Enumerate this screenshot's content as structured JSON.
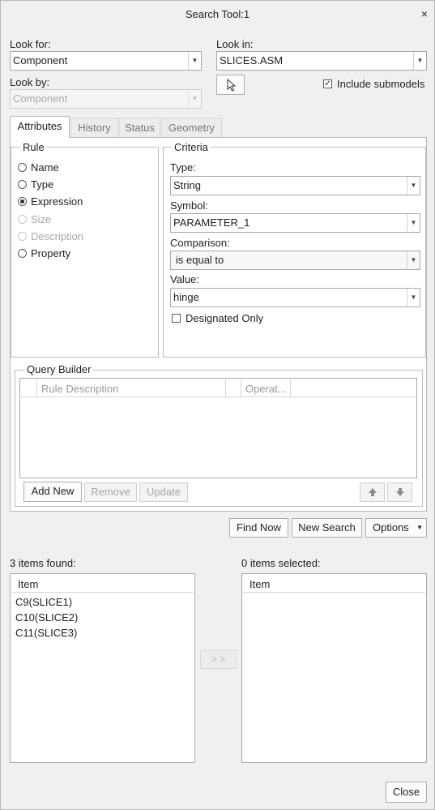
{
  "window": {
    "title": "Search Tool:1",
    "close_glyph": "×"
  },
  "look_for": {
    "label": "Look for:",
    "value": "Component"
  },
  "look_in": {
    "label": "Look in:",
    "value": "SLICES.ASM"
  },
  "look_by": {
    "label": "Look by:",
    "value": "Component"
  },
  "include_submodels": {
    "label": "Include submodels",
    "checked": true
  },
  "tabs": [
    "Attributes",
    "History",
    "Status",
    "Geometry"
  ],
  "rule": {
    "title": "Rule",
    "options": [
      "Name",
      "Type",
      "Expression",
      "Size",
      "Description",
      "Property"
    ],
    "selected": "Expression",
    "disabled": [
      "Size",
      "Description"
    ]
  },
  "criteria": {
    "title": "Criteria",
    "type_label": "Type:",
    "type_value": "String",
    "symbol_label": "Symbol:",
    "symbol_value": "PARAMETER_1",
    "comparison_label": "Comparison:",
    "comparison_value": "is equal to",
    "value_label": "Value:",
    "value_value": "hinge",
    "designated_only": "Designated Only"
  },
  "query_builder": {
    "title": "Query Builder",
    "columns": [
      "Rule Description",
      "Operat..."
    ],
    "add_new": "Add New",
    "remove": "Remove",
    "update": "Update",
    "up_glyph": "🡅",
    "down_glyph": "🡇"
  },
  "actions": {
    "find_now": "Find Now",
    "new_search": "New Search",
    "options": "Options"
  },
  "results": {
    "found_label": "3 items found:",
    "selected_label": "0 items selected:",
    "column": "Item",
    "found_items": [
      "C9(SLICE1)",
      "C10(SLICE2)",
      "C11(SLICE3)"
    ],
    "move_glyph": "> >"
  },
  "close_button": "Close",
  "icons": {
    "dropdown": "chevron-down-icon",
    "pick": "cursor-arrow-icon"
  }
}
